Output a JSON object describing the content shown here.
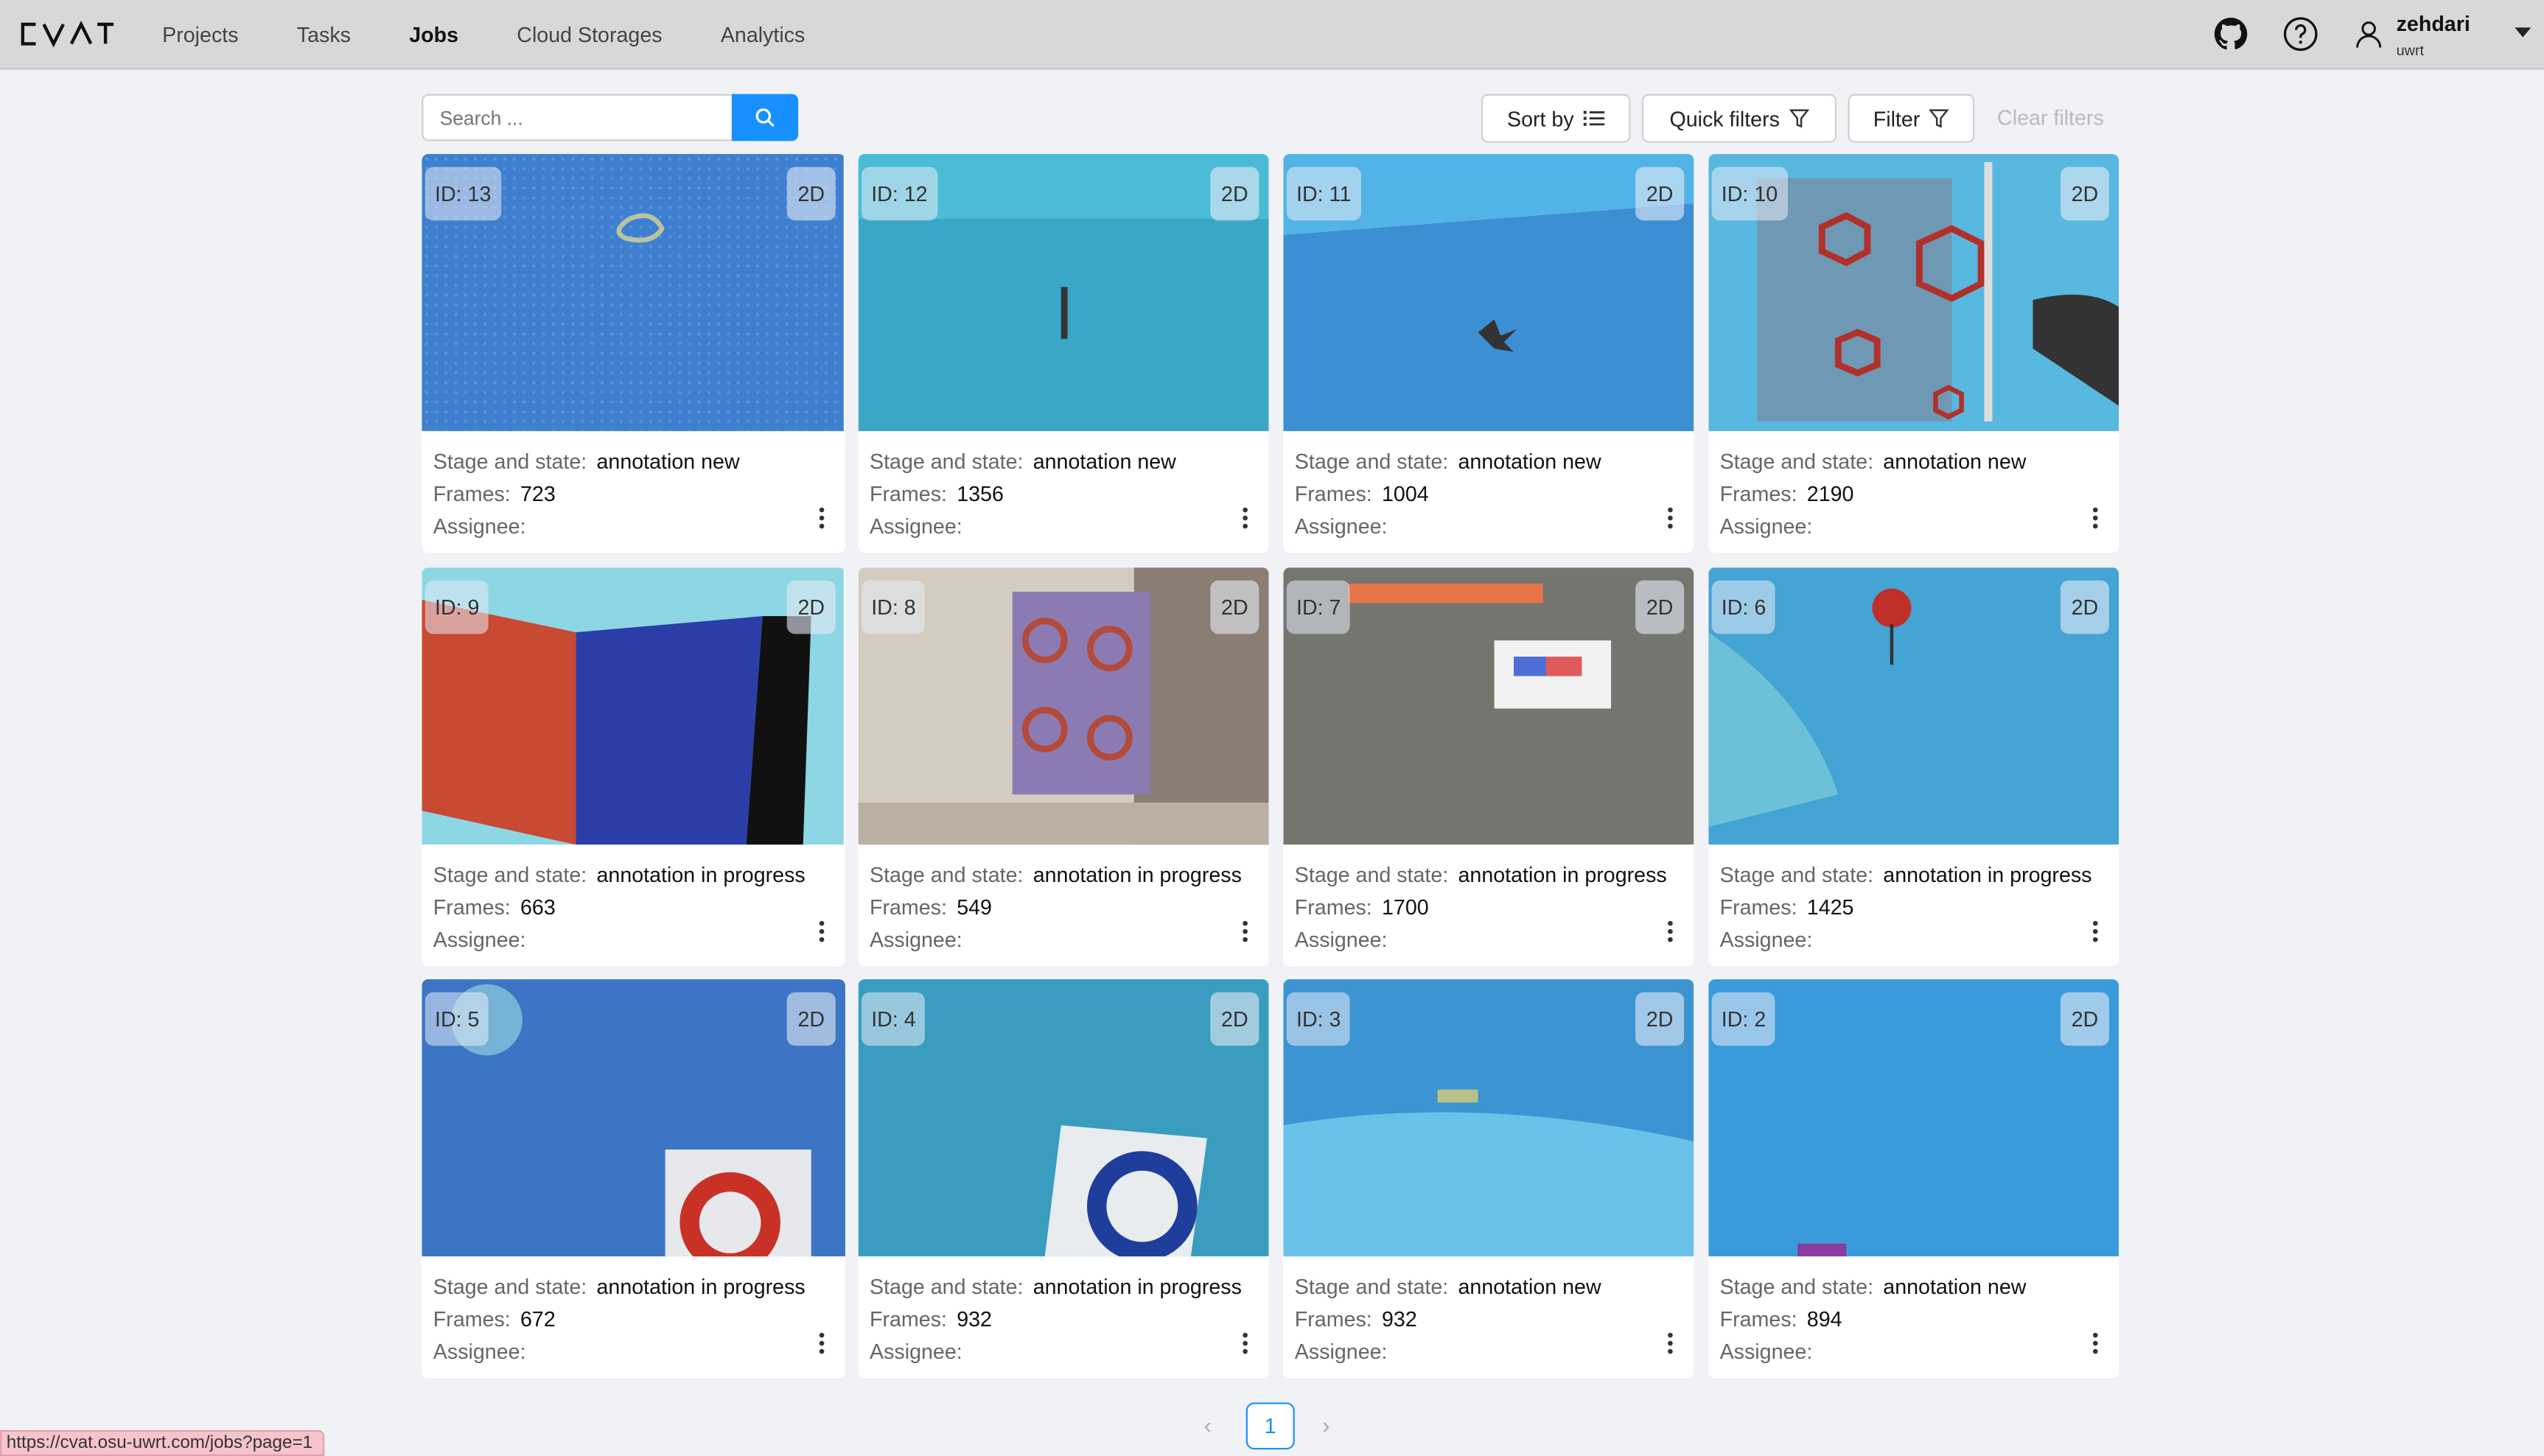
{
  "app": {
    "logo_text": "CVAT"
  },
  "nav": {
    "items": [
      {
        "label": "Projects",
        "active": false
      },
      {
        "label": "Tasks",
        "active": false
      },
      {
        "label": "Jobs",
        "active": true
      },
      {
        "label": "Cloud Storages",
        "active": false
      },
      {
        "label": "Analytics",
        "active": false
      }
    ]
  },
  "user": {
    "name": "zehdari",
    "org": "uwrt"
  },
  "toolbar": {
    "search_placeholder": "Search ...",
    "sort_label": "Sort by",
    "quick_filters_label": "Quick filters",
    "filter_label": "Filter",
    "clear_filters_label": "Clear filters"
  },
  "labels": {
    "stage_state": "Stage and state",
    "frames": "Frames",
    "assignee": "Assignee"
  },
  "jobs": [
    {
      "id": "ID: 13",
      "dim": "2D",
      "state": "annotation new",
      "frames": "723",
      "assignee": ""
    },
    {
      "id": "ID: 12",
      "dim": "2D",
      "state": "annotation new",
      "frames": "1356",
      "assignee": ""
    },
    {
      "id": "ID: 11",
      "dim": "2D",
      "state": "annotation new",
      "frames": "1004",
      "assignee": ""
    },
    {
      "id": "ID: 10",
      "dim": "2D",
      "state": "annotation new",
      "frames": "2190",
      "assignee": ""
    },
    {
      "id": "ID: 9",
      "dim": "2D",
      "state": "annotation in progress",
      "frames": "663",
      "assignee": ""
    },
    {
      "id": "ID: 8",
      "dim": "2D",
      "state": "annotation in progress",
      "frames": "549",
      "assignee": ""
    },
    {
      "id": "ID: 7",
      "dim": "2D",
      "state": "annotation in progress",
      "frames": "1700",
      "assignee": ""
    },
    {
      "id": "ID: 6",
      "dim": "2D",
      "state": "annotation in progress",
      "frames": "1425",
      "assignee": ""
    },
    {
      "id": "ID: 5",
      "dim": "2D",
      "state": "annotation in progress",
      "frames": "672",
      "assignee": ""
    },
    {
      "id": "ID: 4",
      "dim": "2D",
      "state": "annotation in progress",
      "frames": "932",
      "assignee": ""
    },
    {
      "id": "ID: 3",
      "dim": "2D",
      "state": "annotation new",
      "frames": "932",
      "assignee": ""
    },
    {
      "id": "ID: 2",
      "dim": "2D",
      "state": "annotation new",
      "frames": "894",
      "assignee": ""
    }
  ],
  "pagination": {
    "current": "1",
    "prev": "‹",
    "next": "›"
  },
  "status_bar": {
    "url": "https://cvat.osu-uwrt.com/jobs?page=1"
  },
  "colors": {
    "accent": "#1890ff",
    "header_bg": "#d8d8d8",
    "page_bg": "#f0f2f5"
  }
}
